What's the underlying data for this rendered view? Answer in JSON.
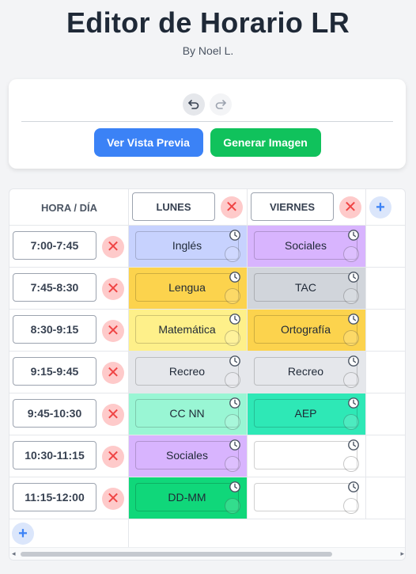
{
  "app": {
    "title": "Editor de Horario LR",
    "subtitle": "By Noel L."
  },
  "toolbar": {
    "undo_icon": "undo-icon",
    "redo_icon": "redo-icon",
    "preview_label": "Ver Vista Previa",
    "generate_label": "Generar Imagen"
  },
  "table": {
    "header_label": "HORA / DÍA",
    "days": [
      "LUNES",
      "VIERNES"
    ],
    "rows": [
      {
        "time": "7:00-7:45",
        "cells": [
          {
            "text": "Inglés",
            "color": "#c7d2fe"
          },
          {
            "text": "Sociales",
            "color": "#d8b4fe"
          }
        ]
      },
      {
        "time": "7:45-8:30",
        "cells": [
          {
            "text": "Lengua",
            "color": "#fcd34d"
          },
          {
            "text": "TAC",
            "color": "#d1d5db"
          }
        ]
      },
      {
        "time": "8:30-9:15",
        "cells": [
          {
            "text": "Matemática",
            "color": "#fef08a"
          },
          {
            "text": "Ortografía",
            "color": "#fcd34d"
          }
        ]
      },
      {
        "time": "9:15-9:45",
        "cells": [
          {
            "text": "Recreo",
            "color": "#e5e7eb"
          },
          {
            "text": "Recreo",
            "color": "#e5e7eb"
          }
        ]
      },
      {
        "time": "9:45-10:30",
        "cells": [
          {
            "text": "CC NN",
            "color": "#99f6d4"
          },
          {
            "text": "AEP",
            "color": "#2ee8b6"
          }
        ]
      },
      {
        "time": "10:30-11:15",
        "cells": [
          {
            "text": "Sociales",
            "color": "#d8b4fe"
          },
          {
            "text": "",
            "color": "#ffffff"
          }
        ]
      },
      {
        "time": "11:15-12:00",
        "cells": [
          {
            "text": "DD-MM",
            "color": "#10d77a"
          },
          {
            "text": "",
            "color": "#ffffff"
          }
        ]
      }
    ],
    "add_symbol": "+",
    "delete_symbol": "✕",
    "icons": {
      "clock": "clock-icon",
      "delete": "close-icon",
      "add": "plus-icon"
    }
  }
}
